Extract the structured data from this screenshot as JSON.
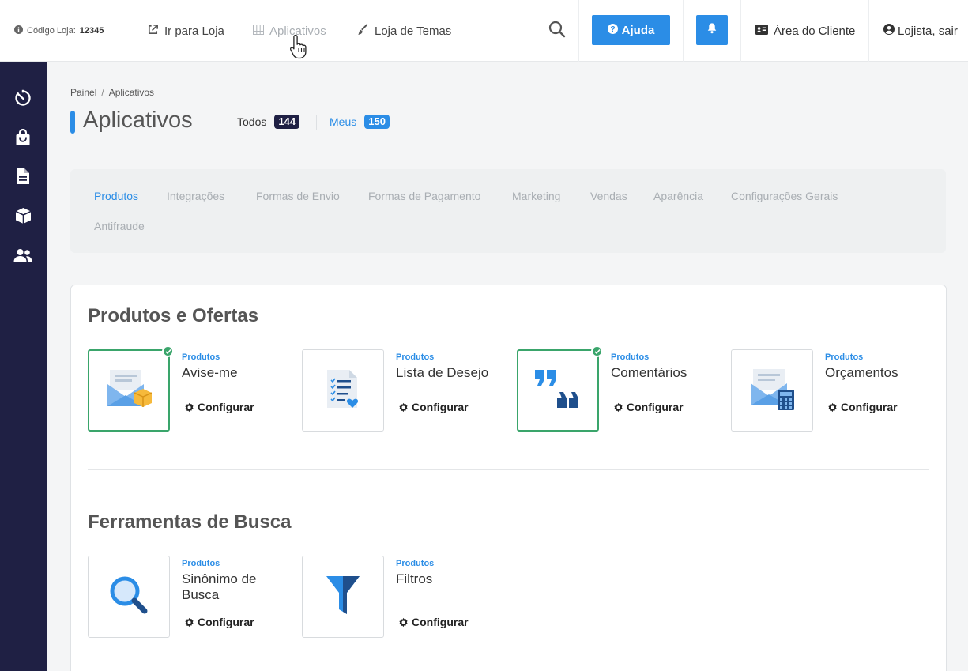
{
  "topbar": {
    "store_code_label": "Código Loja:",
    "store_code_value": "12345",
    "go_to_store": "Ir para Loja",
    "applications": "Aplicativos",
    "theme_store": "Loja de Temas",
    "help": "Ajuda",
    "client_area": "Área do Cliente",
    "user": "Lojista, sair"
  },
  "breadcrumb": {
    "root": "Painel",
    "separator": "/",
    "current": "Aplicativos"
  },
  "page": {
    "title": "Aplicativos",
    "filter_all_label": "Todos",
    "filter_all_count": "144",
    "filter_mine_label": "Meus",
    "filter_mine_count": "150"
  },
  "categories": [
    "Produtos",
    "Integrações",
    "Formas de Envio",
    "Formas de Pagamento",
    "Marketing",
    "Vendas",
    "Aparência",
    "Configurações Gerais",
    "Antifraude"
  ],
  "active_category": "Produtos",
  "sections": [
    {
      "title": "Produtos e Ofertas",
      "apps": [
        {
          "category": "Produtos",
          "name": "Avise-me",
          "action": "Configurar",
          "installed": true,
          "icon": "envelope-box-icon"
        },
        {
          "category": "Produtos",
          "name": "Lista de Desejo",
          "action": "Configurar",
          "installed": false,
          "icon": "wishlist-icon"
        },
        {
          "category": "Produtos",
          "name": "Comentários",
          "action": "Configurar",
          "installed": true,
          "icon": "quotes-icon"
        },
        {
          "category": "Produtos",
          "name": "Orçamentos",
          "action": "Configurar",
          "installed": false,
          "icon": "envelope-calculator-icon"
        }
      ]
    },
    {
      "title": "Ferramentas de Busca",
      "apps": [
        {
          "category": "Produtos",
          "name": "Sinônimo de Busca",
          "action": "Configurar",
          "installed": false,
          "icon": "magnifier-icon"
        },
        {
          "category": "Produtos",
          "name": "Filtros",
          "action": "Configurar",
          "installed": false,
          "icon": "funnel-icon"
        }
      ]
    }
  ],
  "colors": {
    "accent": "#2b8de6",
    "sidebar": "#1f2044",
    "installed": "#3aa56b"
  }
}
